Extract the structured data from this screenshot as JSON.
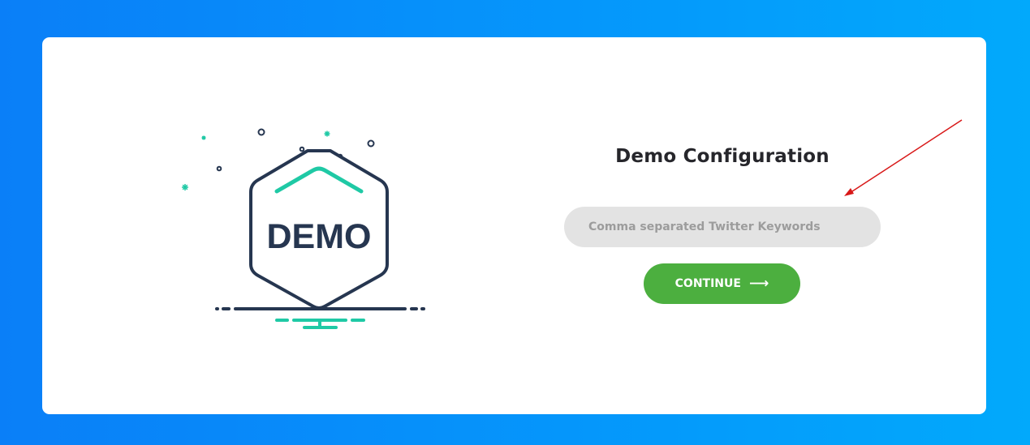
{
  "page": {
    "title": "Demo Configuration"
  },
  "illustration": {
    "label": "DEMO",
    "icon": "demo-hexagon-illustration"
  },
  "form": {
    "keywords_placeholder": "Comma separated Twitter Keywords",
    "keywords_value": "",
    "continue_label": "CONTINUE",
    "continue_icon": "arrow-right-icon",
    "continue_color": "#4caf3f"
  },
  "annotation": {
    "arrow_color": "#d81818"
  },
  "colors": {
    "background_start": "#0a7ff8",
    "background_end": "#02a9fb",
    "accent_teal": "#1fc9a5",
    "outline_navy": "#263650"
  }
}
